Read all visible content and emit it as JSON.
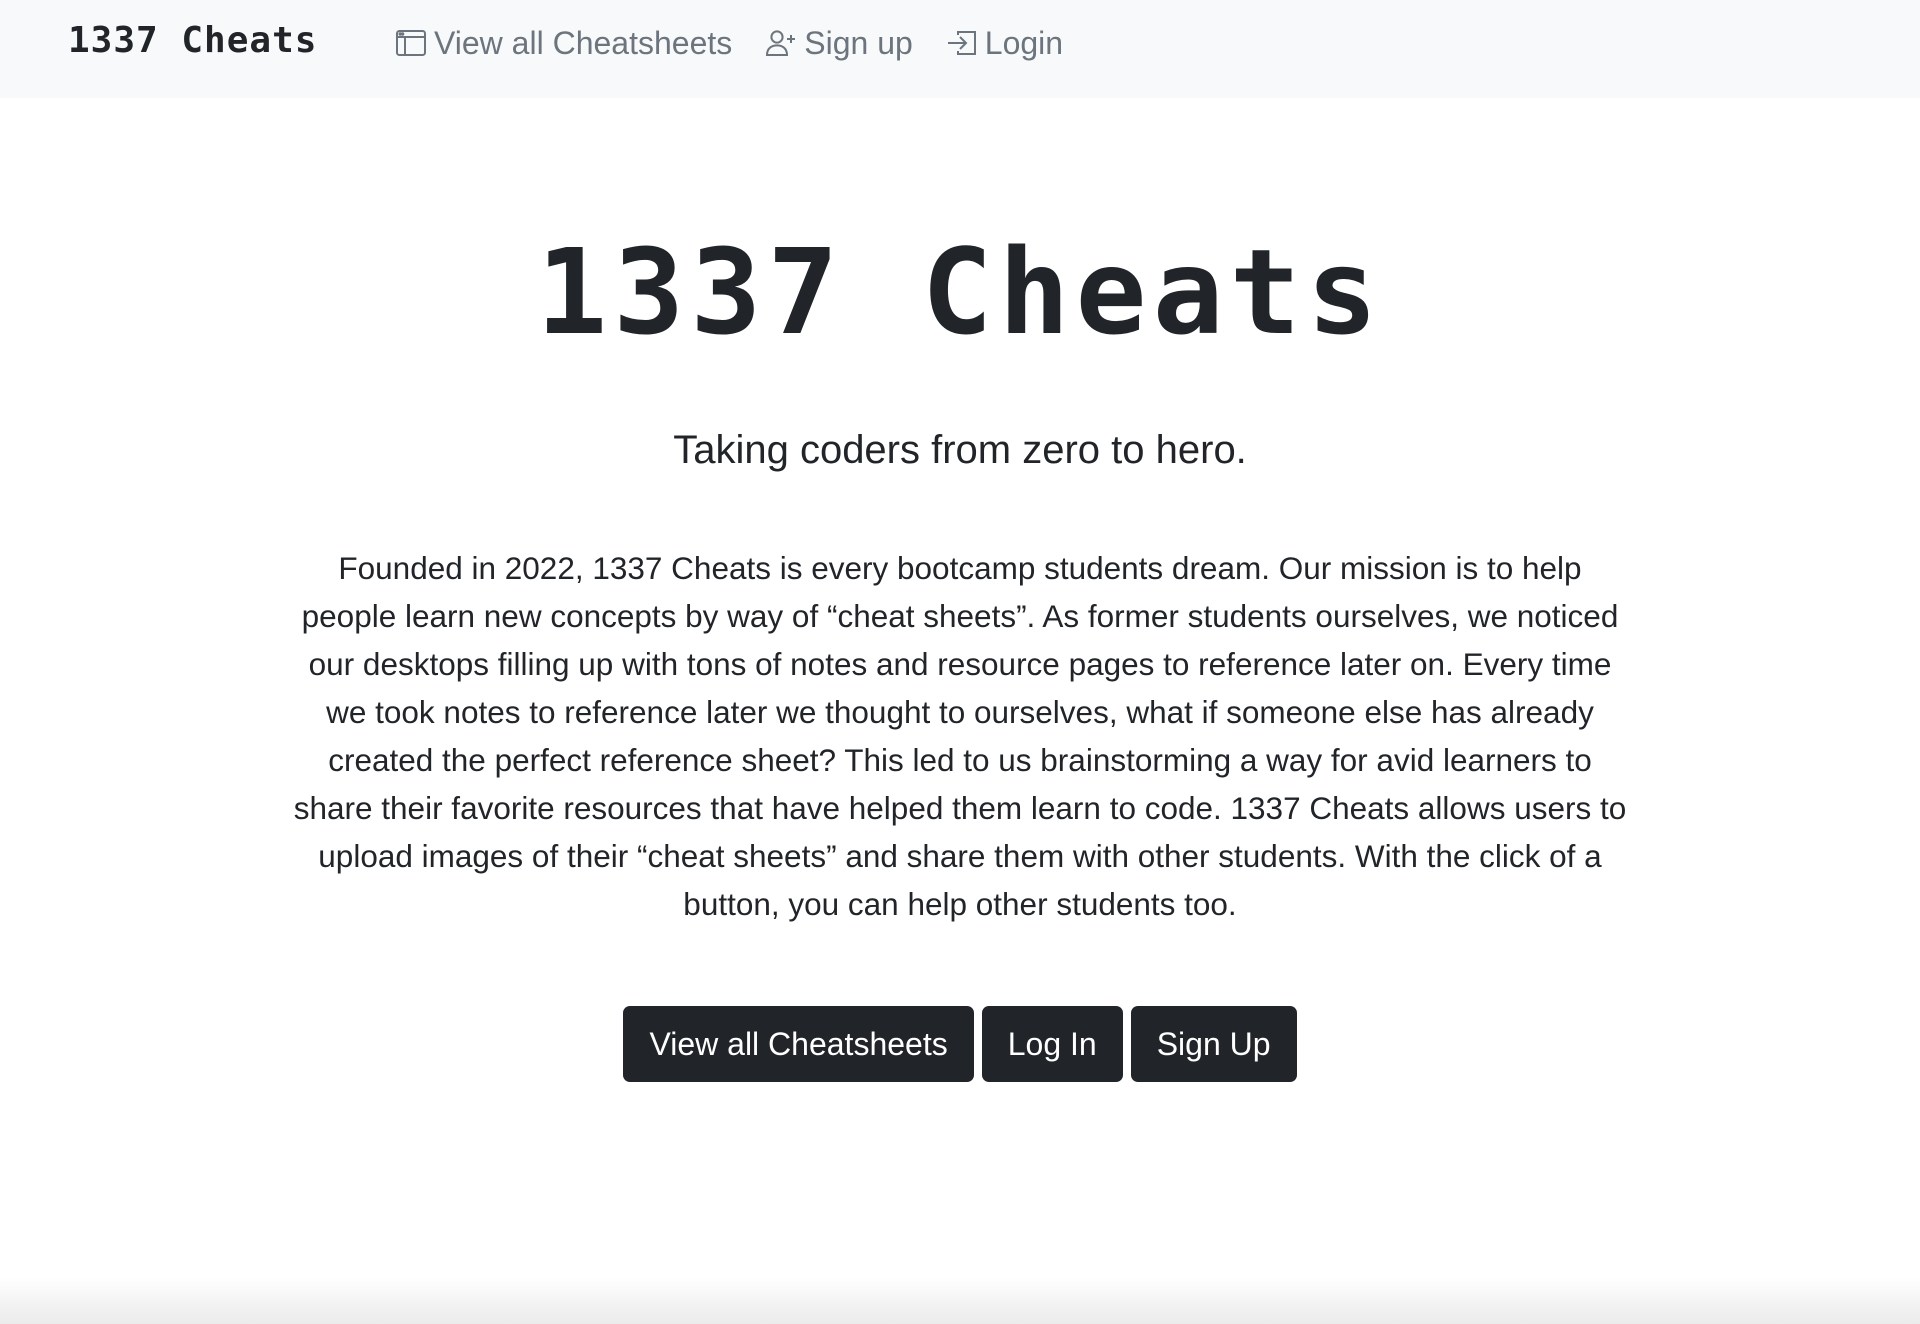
{
  "navbar": {
    "brand": "1337 Cheats",
    "links": [
      {
        "label": "View all Cheatsheets",
        "icon": "window-icon"
      },
      {
        "label": "Sign up",
        "icon": "person-plus-icon"
      },
      {
        "label": "Login",
        "icon": "box-arrow-in-right-icon"
      }
    ]
  },
  "hero": {
    "title": "1337 Cheats",
    "subtitle": "Taking coders from zero to hero.",
    "body": "Founded in 2022, 1337 Cheats is every bootcamp students dream. Our mission is to help people learn new concepts by way of “cheat sheets”. As former students ourselves, we noticed our desktops filling up with tons of notes and resource pages to reference later on. Every time we took notes to reference later we thought to ourselves, what if someone else has already created the perfect reference sheet? This led to us brainstorming a way for avid learners to share their favorite resources that have helped them learn to code. 1337 Cheats allows users to upload images of their “cheat sheets” and share them with other students. With the click of a button, you can help other students too.",
    "buttons": [
      {
        "label": "View all Cheatsheets"
      },
      {
        "label": "Log In"
      },
      {
        "label": "Sign Up"
      }
    ]
  },
  "colors": {
    "navbar_bg": "#f8f9fa",
    "nav_link": "#6c757d",
    "text": "#212529",
    "button_bg": "#212529",
    "button_text": "#ffffff"
  }
}
